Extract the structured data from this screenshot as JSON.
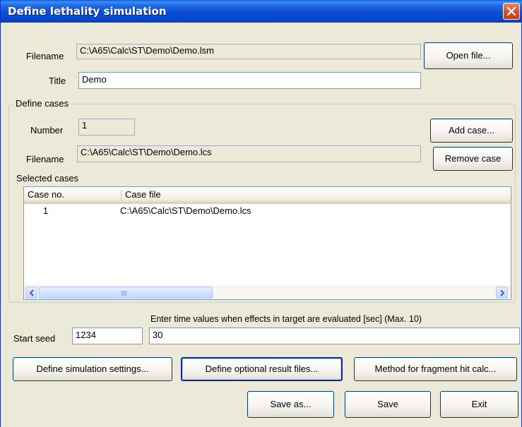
{
  "window": {
    "title": "Define lethality simulation"
  },
  "form": {
    "filename_label": "Filename",
    "filename_value": "C:\\A65\\Calc\\ST\\Demo\\Demo.lsm",
    "title_label": "Title",
    "title_value": "Demo",
    "open_file_label": "Open file..."
  },
  "cases": {
    "group_title": "Define cases",
    "number_label": "Number",
    "number_value": "1",
    "filename_label": "Filename",
    "filename_value": "C:\\A65\\Calc\\ST\\Demo\\Demo.lcs",
    "add_case_label": "Add case...",
    "remove_case_label": "Remove case",
    "selected_label": "Selected cases",
    "columns": [
      "Case no.",
      "Case file"
    ],
    "rows": [
      {
        "case_no": "1",
        "case_file": "C:\\A65\\Calc\\ST\\Demo\\Demo.lcs"
      }
    ]
  },
  "seed": {
    "label": "Start seed",
    "value": "1234"
  },
  "time": {
    "label": "Enter time values when effects in target are evaluated [sec] (Max. 10)",
    "value": "30"
  },
  "buttons": {
    "simulation_settings": "Define simulation settings...",
    "optional_result_files": "Define optional result files...",
    "fragment_hit_method": "Method for fragment hit calc...",
    "save_as": "Save as...",
    "save": "Save",
    "exit": "Exit"
  }
}
